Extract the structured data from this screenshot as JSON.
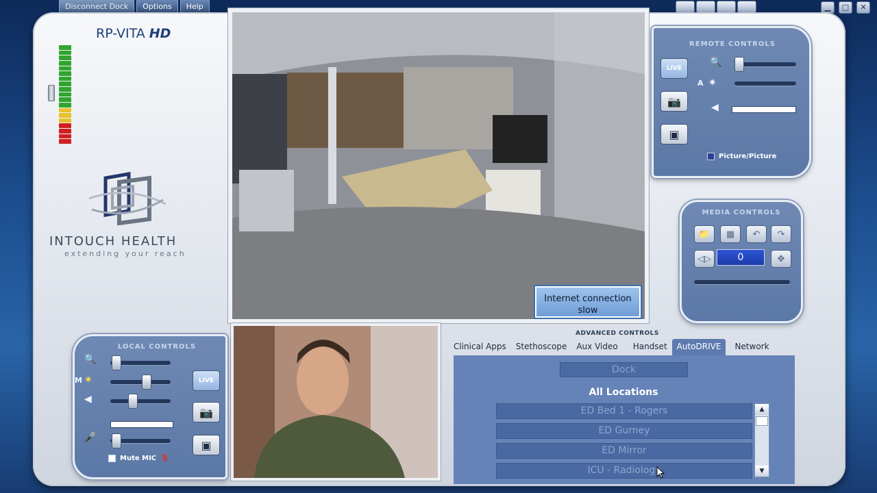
{
  "menu": {
    "disconnect": "Disconnect Dock",
    "options": "Options",
    "help": "Help"
  },
  "product": {
    "name": "RP-VITA",
    "suffix": "HD"
  },
  "brand": {
    "name": "INTOUCH HEALTH",
    "tagline": "extending your reach"
  },
  "status_message": "Internet connection slow",
  "remote_controls": {
    "title": "REMOTE CONTROLS",
    "live": "LIVE",
    "auto_label": "A",
    "pip_label": "Picture/Picture"
  },
  "media_controls": {
    "title": "MEDIA CONTROLS",
    "counter": "0"
  },
  "local_controls": {
    "title": "LOCAL CONTROLS",
    "live": "LIVE",
    "m_label": "M",
    "mute_label": "Mute MIC"
  },
  "advanced": {
    "title": "ADVANCED CONTROLS",
    "tabs": [
      "Clinical Apps",
      "Stethoscope",
      "Aux Video",
      "Handset",
      "AutoDRIVE",
      "Network"
    ],
    "active_tab": "AutoDRIVE",
    "dock_label": "Dock",
    "locations_title": "All Locations",
    "locations": [
      "ED Bed 1 - Rogers",
      "ED Gurney",
      "ED Mirror",
      "ICU - Radiology"
    ]
  },
  "colors": {
    "panel": "#5c78a6",
    "accent": "#2d54d6",
    "signal_green": "#2fa52f",
    "signal_yellow": "#e6c22c",
    "signal_red": "#d02121"
  },
  "icons": [
    "zoom-icon",
    "brightness-icon",
    "volume-icon",
    "mic-icon",
    "camera-icon",
    "video-record-icon",
    "folder-icon",
    "save-icon",
    "undo-icon",
    "redo-icon",
    "minimize-icon",
    "maximize-icon",
    "close-icon"
  ]
}
